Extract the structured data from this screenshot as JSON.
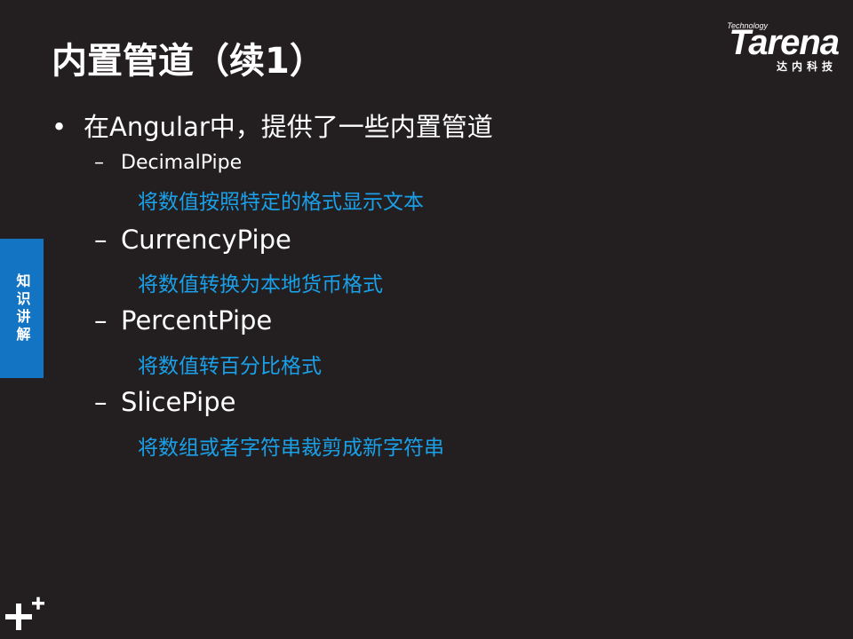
{
  "slide": {
    "title": "内置管道（续1）"
  },
  "logo": {
    "tech": "Technology",
    "word": "Tarena",
    "cn": "达内科技"
  },
  "side_tab": {
    "label": "知识讲解"
  },
  "content": {
    "bullet_marker": "•",
    "main_bullet": "在Angular中，提供了一些内置管道",
    "dash": "–",
    "items": [
      {
        "name": "DecimalPipe",
        "desc": "将数值按照特定的格式显示文本"
      },
      {
        "name": "CurrencyPipe",
        "desc": "将数值转换为本地货币格式"
      },
      {
        "name": "PercentPipe",
        "desc": "将数值转百分比格式"
      },
      {
        "name": "SlicePipe",
        "desc": "将数组或者字符串裁剪成新字符串"
      }
    ]
  },
  "colors": {
    "background": "#231f20",
    "accent_blue": "#1aa0e8",
    "tab_blue": "#1474c4",
    "text": "#ffffff"
  },
  "icons": {
    "corner": "plus-mark-icon"
  }
}
